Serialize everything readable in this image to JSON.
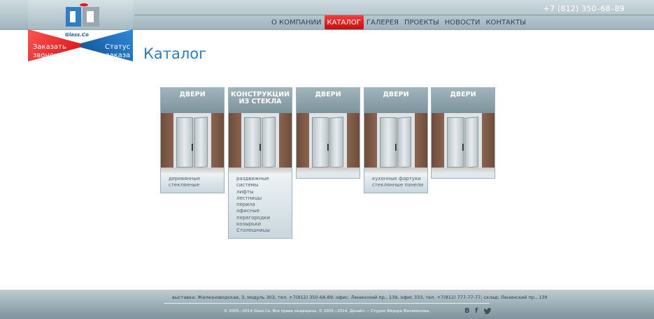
{
  "header": {
    "phone": "+7 (812) 350–68–89",
    "nav": [
      {
        "label": "О КОМПАНИИ",
        "active": false
      },
      {
        "label": "КАТАЛОГ",
        "active": true
      },
      {
        "label": "ГАЛЕРЕЯ",
        "active": false
      },
      {
        "label": "ПРОЕКТЫ",
        "active": false
      },
      {
        "label": "НОВОСТИ",
        "active": false
      },
      {
        "label": "КОНТАКТЫ",
        "active": false
      }
    ]
  },
  "logo": {
    "text": "Glass.Co",
    "callback_line1": "Заказать",
    "callback_line2": "звонок",
    "status_line1": "Статус",
    "status_line2": "заказа"
  },
  "page": {
    "title": "Каталог"
  },
  "cards": [
    {
      "title": "ДВЕРИ",
      "items": [
        "деревянные",
        "стеклянные"
      ]
    },
    {
      "title": "КОНСТРУКЦИИ ИЗ СТЕКЛА",
      "items": [
        "раздвижные системы",
        "лифты",
        "лестницы",
        "перила",
        "офисные",
        "перегородки",
        "козырьки",
        "Столешницы"
      ]
    },
    {
      "title": "ДВЕРИ",
      "items": []
    },
    {
      "title": "ДВЕРИ",
      "items": [
        "кухонные фартуки",
        "стеклянные панели"
      ]
    },
    {
      "title": "ДВЕРИ",
      "items": []
    }
  ],
  "footer": {
    "address": "выставка: Железноводская, 3, модуль 303, тел. +7(812) 350-68-89; офис: Ленинский пр., 139, офис 333, тел. +7(812) 777-77-77; склад: Ленинский пр., 139",
    "copyright": "© 2005—2014 Glass.Co. Все права защищены. © 2005—2014, Дизайн — Студия Фёдора Филимонова.",
    "social": [
      "В",
      "f"
    ]
  },
  "colors": {
    "accent": "#2a7fc2",
    "nav_active": "#e01616",
    "callback": "#e21b1b",
    "status": "#1d67b0"
  }
}
